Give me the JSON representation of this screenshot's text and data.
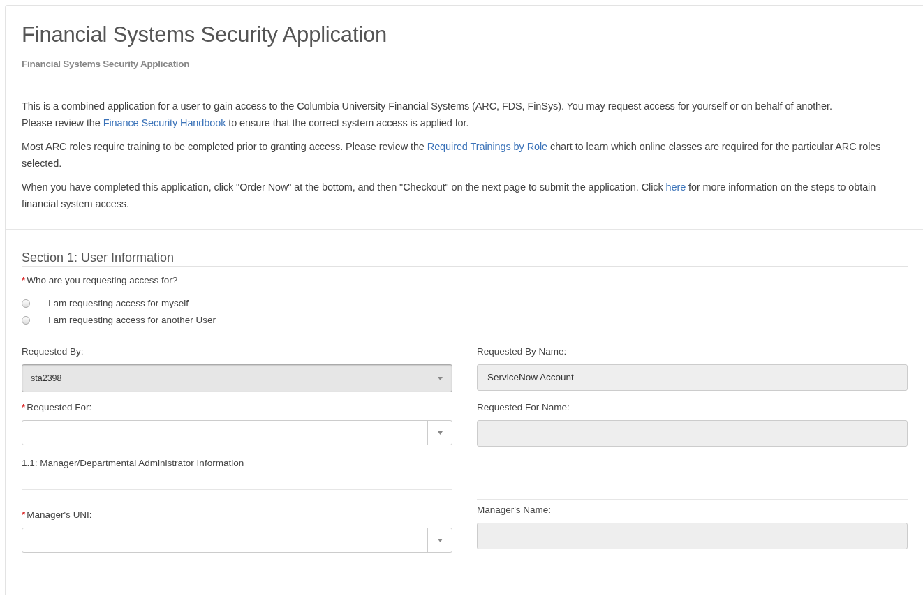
{
  "header": {
    "title": "Financial Systems Security Application",
    "subtitle": "Financial Systems Security Application"
  },
  "intro": [
    {
      "segments": [
        {
          "kind": "text",
          "text": "This is a combined application for a user to gain access to the Columbia University Financial Systems (ARC, FDS, FinSys). You may request access for yourself or on behalf of another."
        },
        {
          "kind": "break"
        },
        {
          "kind": "text",
          "text": "Please review the "
        },
        {
          "kind": "link",
          "text": "Finance Security Handbook"
        },
        {
          "kind": "text",
          "text": " to ensure that the correct system access is applied for."
        }
      ]
    },
    {
      "segments": [
        {
          "kind": "text",
          "text": "Most ARC roles require training to be completed prior to granting access. Please review the "
        },
        {
          "kind": "link",
          "text": "Required Trainings by Role"
        },
        {
          "kind": "text",
          "text": " chart to learn which online classes are required for the particular ARC roles selected."
        }
      ]
    },
    {
      "segments": [
        {
          "kind": "text",
          "text": "When you have completed this application, click \"Order Now\" at the bottom, and then \"Checkout\" on the next page to submit the application. Click "
        },
        {
          "kind": "link",
          "text": "here"
        },
        {
          "kind": "text",
          "text": " for more information on the steps to obtain financial system access."
        }
      ]
    }
  ],
  "section": {
    "title": "Section 1: User Information",
    "question": {
      "label": "Who are you requesting access for?",
      "marker": "*",
      "options": [
        {
          "label": "I am requesting access for myself",
          "selected": false
        },
        {
          "label": "I am requesting access for another User",
          "selected": false
        }
      ]
    },
    "rows": [
      {
        "left": {
          "label": "Requested By:",
          "kind": "select",
          "value": "sta2398",
          "disabled": true
        },
        "right": {
          "label": "Requested By Name:",
          "kind": "text",
          "value": "ServiceNow Account",
          "disabled": true
        }
      },
      {
        "left": {
          "label": "Requested For:",
          "marker": "*",
          "kind": "select",
          "disabled": false
        },
        "right": {
          "label": "Requested For Name:",
          "kind": "text",
          "disabled": true
        }
      }
    ],
    "subsection": {
      "title": "1.1: Manager/Departmental Administrator Information",
      "rows": [
        {
          "left": {
            "label": "Manager's UNI:",
            "marker": "*",
            "kind": "select",
            "disabled": false
          },
          "right": {
            "label": "Manager's Name:",
            "kind": "text",
            "disabled": true
          }
        }
      ]
    }
  }
}
